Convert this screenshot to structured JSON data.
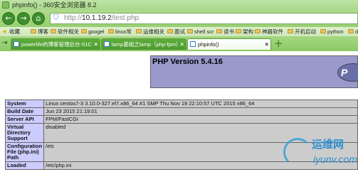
{
  "window": {
    "title": "phpinfo() - 360安全浏览器 8.2"
  },
  "nav": {
    "back_glyph": "←",
    "forward_glyph": "→",
    "home_glyph": "⌂",
    "shield_glyph": "⛉",
    "url_prefix": "http://",
    "url_host": "10.1.19.2",
    "url_path": "/test.php"
  },
  "bookmarks": [
    "收藏",
    "博客",
    "软件相关",
    "googel",
    "linux常",
    "运维相关",
    "面试",
    "shell scr",
    "读书",
    "架构",
    "神器软件",
    "开机启动",
    "python",
    "de"
  ],
  "tabs": [
    {
      "label": "powerlife的博客管理后台-51C",
      "close": "×",
      "active": false
    },
    {
      "label": "lamp基础之lamp（php-fpm）",
      "close": "×",
      "active": false
    },
    {
      "label": "phpinfo()",
      "close": "×",
      "active": true
    }
  ],
  "tabbar": {
    "left_arrow": "⇥",
    "new_tab": "+"
  },
  "php": {
    "version_title": "PHP Version 5.4.16",
    "logo_text": "P",
    "rows": [
      {
        "key": "System",
        "value": "Linux centos7-3 3.10.0-327.el7.x86_64 #1 SMP Thu Nov 19 22:10:57 UTC 2015 x86_64"
      },
      {
        "key": "Build Date",
        "value": "Jun 23 2015 21:19:01"
      },
      {
        "key": "Server API",
        "value": "FPM/FastCGI"
      },
      {
        "key": "Virtual Directory Support",
        "value": "disabled"
      },
      {
        "key": "Configuration File (php.ini) Path",
        "value": "/etc"
      },
      {
        "key": "Loaded",
        "value": "/etc/php.ini"
      }
    ]
  },
  "watermark": {
    "cn": "运维网",
    "en": "iyunv.com"
  },
  "colors": {
    "browser_green": "#97cf71",
    "php_header": "#9999cc",
    "php_key_cell": "#ccccff",
    "php_value_cell": "#cccccc"
  }
}
